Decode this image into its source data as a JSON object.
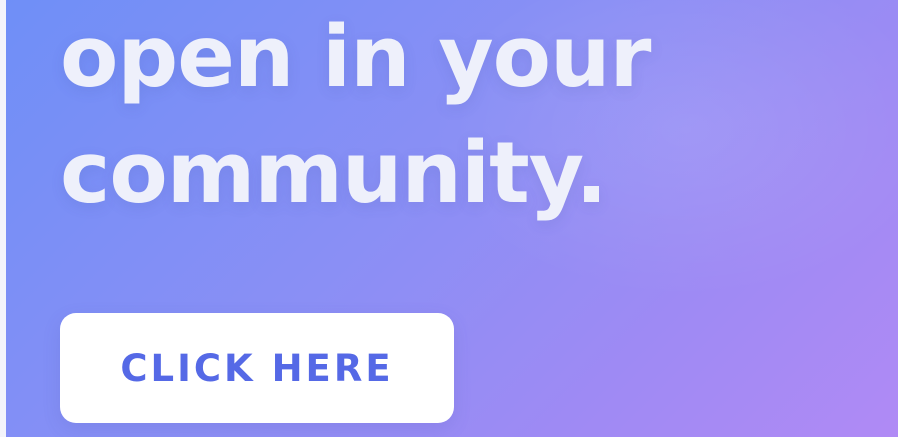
{
  "hero": {
    "headline_line_2": "open in your",
    "headline_line_3": "community."
  },
  "cta": {
    "label": "CLICK HERE"
  },
  "colors": {
    "gradient_start": "#6f8ff7",
    "gradient_end": "#b08af5",
    "headline_text": "#eef0fb",
    "button_background": "#ffffff",
    "button_text": "#5569e6"
  }
}
